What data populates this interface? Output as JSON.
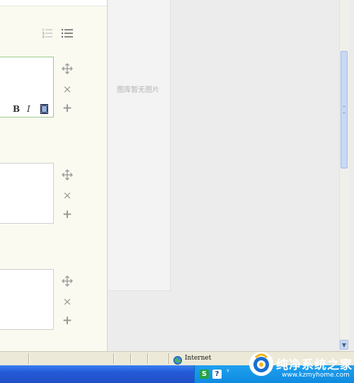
{
  "editor": {
    "toolbar": {
      "ordered_list_icon": "ordered-list-icon",
      "unordered_list_icon": "unordered-list-icon"
    },
    "format": {
      "bold_label": "B",
      "italic_label": "I",
      "video_icon": "video-icon"
    },
    "blocks": [
      {
        "move_icon": "move-icon",
        "delete_label": "×",
        "add_label": "+"
      },
      {
        "move_icon": "move-icon",
        "delete_label": "×",
        "add_label": "+"
      },
      {
        "move_icon": "move-icon",
        "delete_label": "×",
        "add_label": "+"
      }
    ]
  },
  "gallery": {
    "empty_text": "图库暂无图片"
  },
  "status_bar": {
    "zone_label": "Internet",
    "zone_icon": "globe-icon"
  },
  "taskbar": {
    "tray_ime_label": "S",
    "tray_help_label": "?"
  },
  "watermark": {
    "text": "纯净系统之家",
    "url": "www.kzmyhome.com"
  },
  "colors": {
    "accent_border": "#9ccc8a",
    "taskbar": "#2459d6",
    "tray": "#0f8be0"
  }
}
